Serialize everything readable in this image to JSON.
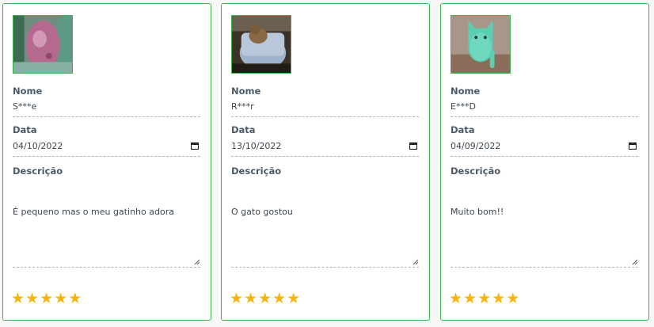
{
  "labels": {
    "name": "Nome",
    "date": "Data",
    "description": "Descrição"
  },
  "reviews": [
    {
      "name": "S***e",
      "date": "04/10/2022",
      "description": "É pequeno mas o meu gatinho adora",
      "rating": 5
    },
    {
      "name": "R***r",
      "date": "13/10/2022",
      "description": "O gato gostou",
      "rating": 5
    },
    {
      "name": "E***D",
      "date": "04/09/2022",
      "description": "Muito bom!!",
      "rating": 5
    }
  ],
  "colors": {
    "border": "#3cb44b",
    "star": "#f6b40e",
    "label": "#4a5a66"
  },
  "icons": {
    "date": "calendar-icon",
    "rating": "star-icon",
    "resize": "resize-handle-icon"
  }
}
